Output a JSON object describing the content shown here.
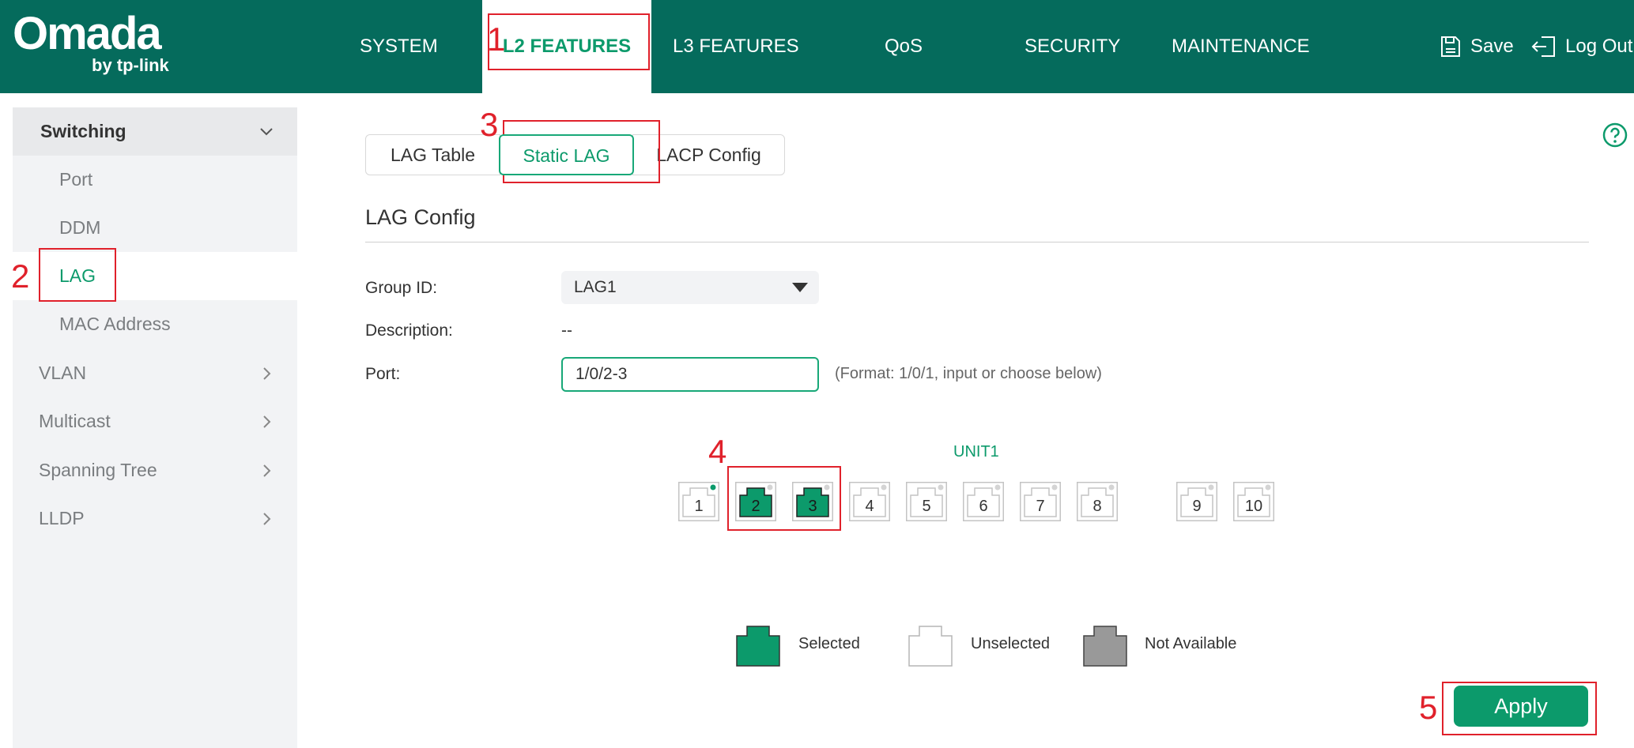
{
  "colors": {
    "header_bg": "#056b5c",
    "accent": "#0c9a6b",
    "annotation": "#e0212b",
    "sidebar_bg": "#f2f3f5"
  },
  "logo": {
    "main": "Omada",
    "sub": "by tp-link"
  },
  "nav": {
    "items": [
      "SYSTEM",
      "L2 FEATURES",
      "L3 FEATURES",
      "QoS",
      "SECURITY",
      "MAINTENANCE"
    ],
    "active": "L2 FEATURES",
    "save_label": "Save",
    "save_icon": "save-icon",
    "logout_label": "Log Out",
    "logout_icon": "logout-icon"
  },
  "sidebar": {
    "group_label": "Switching",
    "sub_items": [
      "Port",
      "DDM",
      "LAG",
      "MAC Address"
    ],
    "active": "LAG",
    "groups": [
      "VLAN",
      "Multicast",
      "Spanning Tree",
      "LLDP"
    ]
  },
  "tabs": {
    "items": [
      "LAG Table",
      "Static LAG",
      "LACP Config"
    ],
    "active": "Static LAG"
  },
  "section_title": "LAG Config",
  "form": {
    "group_id_label": "Group ID:",
    "group_id_value": "LAG1",
    "description_label": "Description:",
    "description_value": "--",
    "port_label": "Port:",
    "port_value": "1/0/2-3",
    "port_hint": "(Format: 1/0/1, input or choose below)"
  },
  "unit": {
    "label": "UNIT1",
    "ports": [
      "1",
      "2",
      "3",
      "4",
      "5",
      "6",
      "7",
      "8",
      "9",
      "10"
    ],
    "selected_ports": [
      "2",
      "3"
    ],
    "link_up_ports": [
      "1"
    ]
  },
  "legend": {
    "selected": "Selected",
    "unselected": "Unselected",
    "not_available": "Not Available"
  },
  "apply_label": "Apply",
  "annotations": [
    "1",
    "2",
    "3",
    "4",
    "5"
  ]
}
